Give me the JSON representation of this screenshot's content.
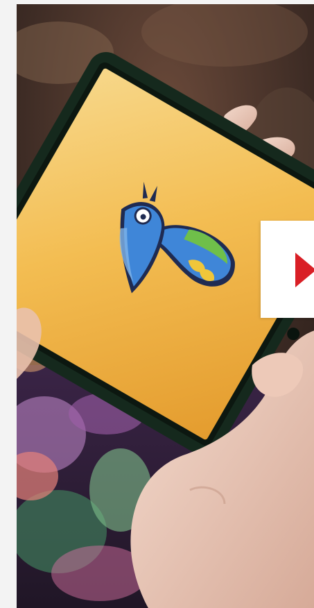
{
  "promo": {
    "media_type": "photo",
    "play_icon": "play-icon",
    "colors": {
      "accent": "#d91f26",
      "tablet_screen": "#f0b446",
      "tablet_frame": "#15291d",
      "bird_blue": "#3f86d8"
    }
  }
}
